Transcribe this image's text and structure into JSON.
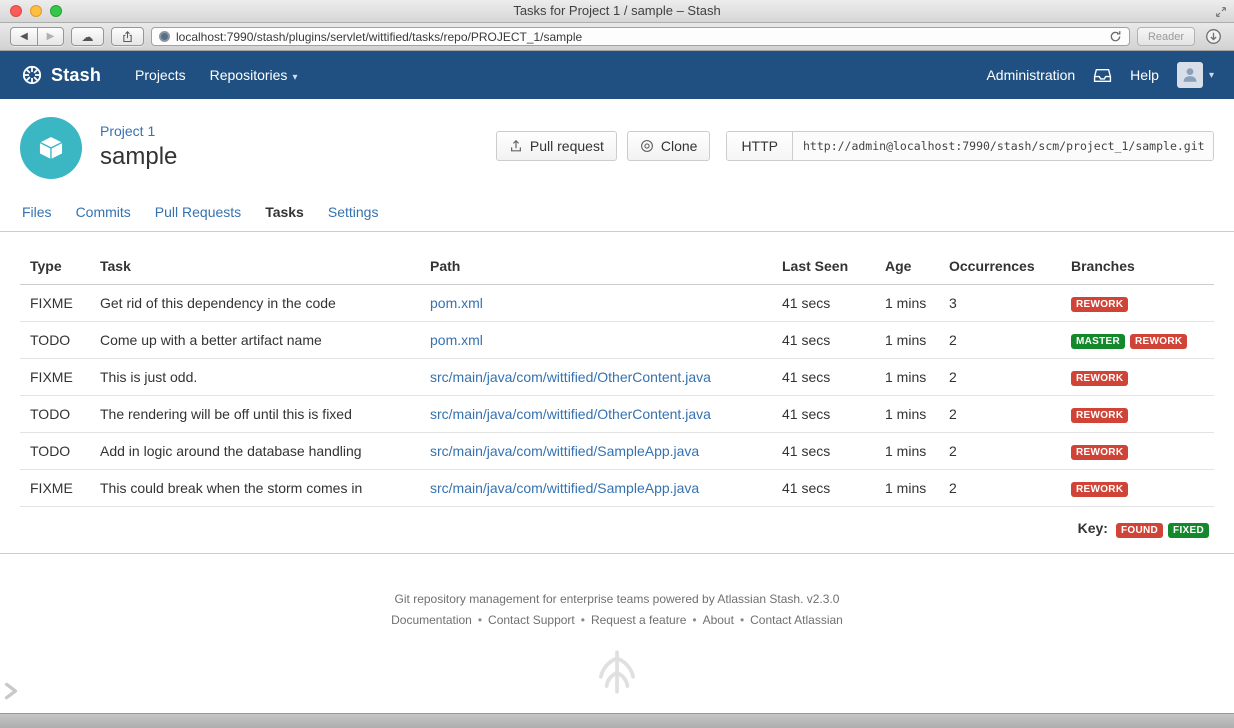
{
  "icons": {
    "back": "◀",
    "forward": "▶",
    "cloud": "☁",
    "caret_down": "▾"
  },
  "browser": {
    "window_title": "Tasks for Project 1 / sample – Stash",
    "url": "localhost:7990/stash/plugins/servlet/wittified/tasks/repo/PROJECT_1/sample",
    "reader_label": "Reader"
  },
  "nav": {
    "brand": "Stash",
    "items": [
      {
        "label": "Projects",
        "caret": false
      },
      {
        "label": "Repositories",
        "caret": true
      }
    ],
    "administration": "Administration",
    "help": "Help"
  },
  "header": {
    "project_name": "Project 1",
    "repo_name": "sample",
    "pull_request_label": "Pull request",
    "clone_label": "Clone",
    "protocol_label": "HTTP",
    "clone_url": "http://admin@localhost:7990/stash/scm/project_1/sample.git"
  },
  "tabs": [
    {
      "label": "Files",
      "active": false
    },
    {
      "label": "Commits",
      "active": false
    },
    {
      "label": "Pull Requests",
      "active": false
    },
    {
      "label": "Tasks",
      "active": true
    },
    {
      "label": "Settings",
      "active": false
    }
  ],
  "table": {
    "columns": [
      "Type",
      "Task",
      "Path",
      "Last Seen",
      "Age",
      "Occurrences",
      "Branches"
    ],
    "rows": [
      {
        "type": "FIXME",
        "task": "Get rid of this dependency in the code",
        "path": "pom.xml",
        "last_seen": "41 secs",
        "age": "1 mins",
        "occurrences": "3",
        "branches": [
          {
            "label": "REWORK",
            "color": "red"
          }
        ]
      },
      {
        "type": "TODO",
        "task": "Come up with a better artifact name",
        "path": "pom.xml",
        "last_seen": "41 secs",
        "age": "1 mins",
        "occurrences": "2",
        "branches": [
          {
            "label": "MASTER",
            "color": "green"
          },
          {
            "label": "REWORK",
            "color": "red"
          }
        ]
      },
      {
        "type": "FIXME",
        "task": "This is just odd.",
        "path": "src/main/java/com/wittified/OtherContent.java",
        "last_seen": "41 secs",
        "age": "1 mins",
        "occurrences": "2",
        "branches": [
          {
            "label": "REWORK",
            "color": "red"
          }
        ]
      },
      {
        "type": "TODO",
        "task": "The rendering will be off until this is fixed",
        "path": "src/main/java/com/wittified/OtherContent.java",
        "last_seen": "41 secs",
        "age": "1 mins",
        "occurrences": "2",
        "branches": [
          {
            "label": "REWORK",
            "color": "red"
          }
        ]
      },
      {
        "type": "TODO",
        "task": "Add in logic around the database handling",
        "path": "src/main/java/com/wittified/SampleApp.java",
        "last_seen": "41 secs",
        "age": "1 mins",
        "occurrences": "2",
        "branches": [
          {
            "label": "REWORK",
            "color": "red"
          }
        ]
      },
      {
        "type": "FIXME",
        "task": "This could break when the storm comes in",
        "path": "src/main/java/com/wittified/SampleApp.java",
        "last_seen": "41 secs",
        "age": "1 mins",
        "occurrences": "2",
        "branches": [
          {
            "label": "REWORK",
            "color": "red"
          }
        ]
      }
    ],
    "key_label": "Key:",
    "key_badges": [
      {
        "label": "FOUND",
        "color": "red"
      },
      {
        "label": "FIXED",
        "color": "green"
      }
    ]
  },
  "footer": {
    "tagline": "Git repository management for enterprise teams powered by Atlassian Stash. v2.3.0",
    "links": [
      "Documentation",
      "Contact Support",
      "Request a feature",
      "About",
      "Contact Atlassian"
    ],
    "separator": "•"
  },
  "colors": {
    "nav_bg": "#205081",
    "link": "#3572b0",
    "project_avatar": "#3bb7c4",
    "badges": {
      "red": "#d04437",
      "green": "#14892c"
    }
  }
}
